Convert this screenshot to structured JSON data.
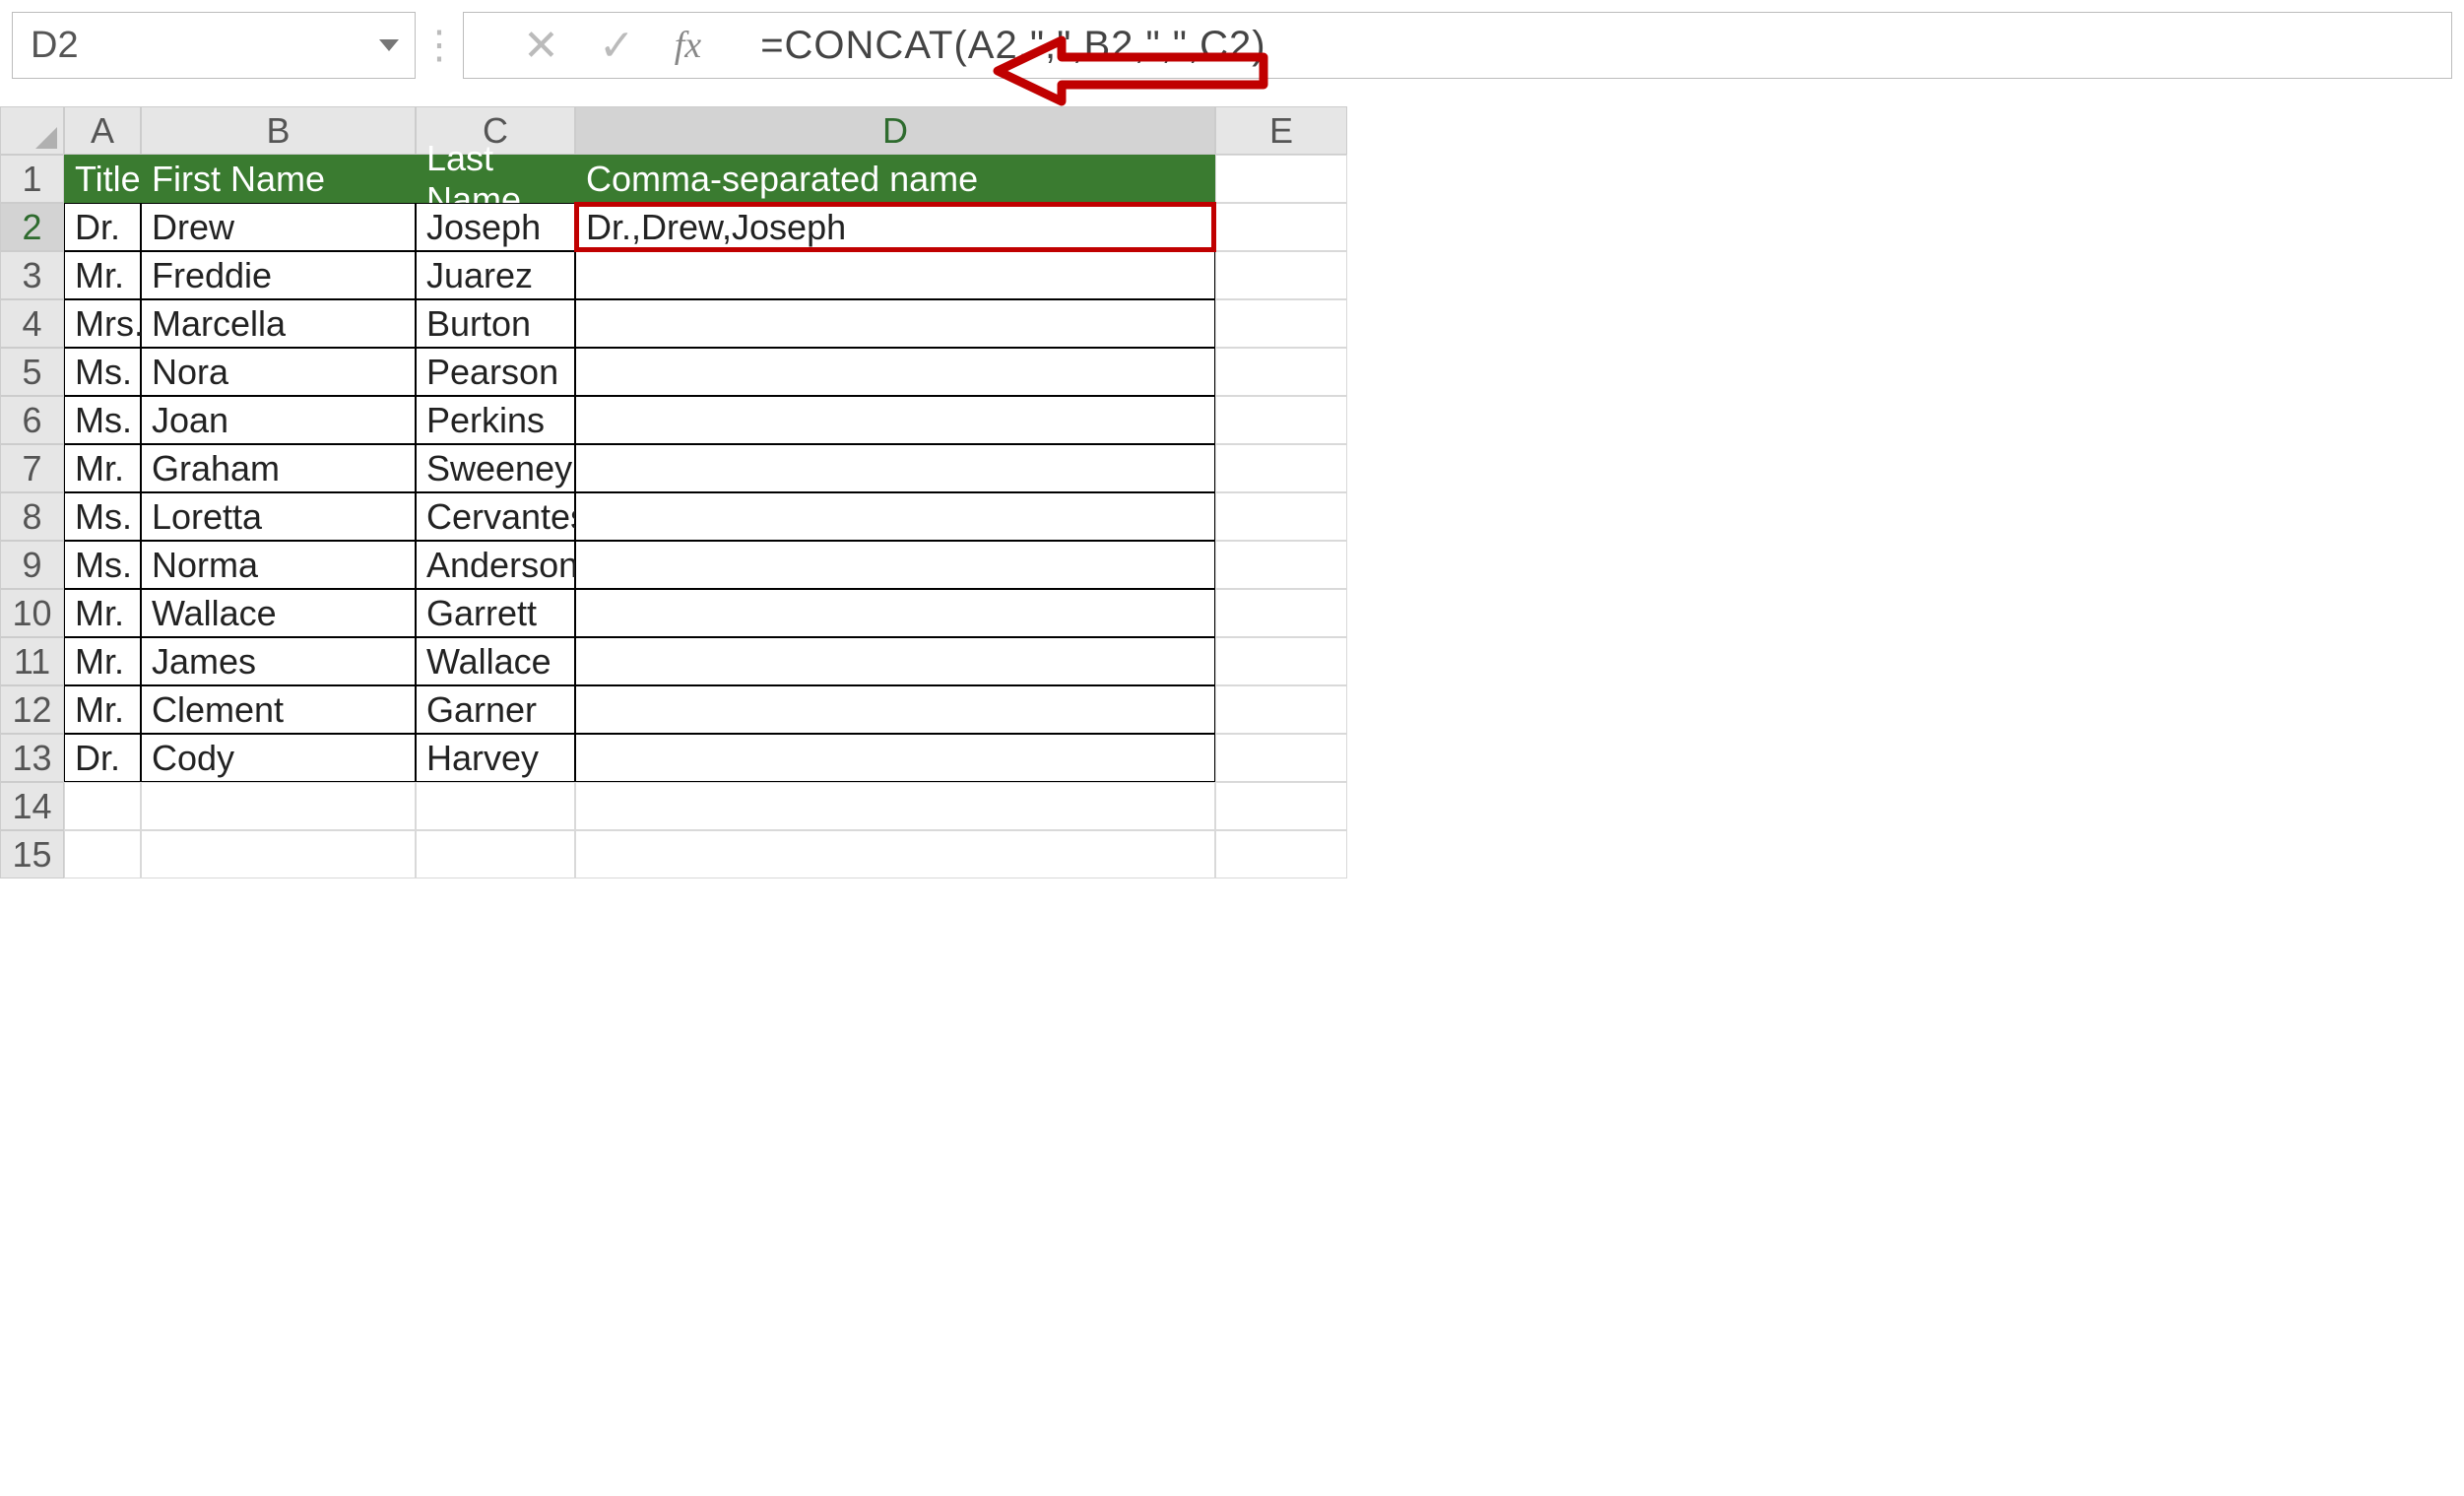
{
  "name_box": {
    "value": "D2"
  },
  "formula_bar": {
    "cancel": "✕",
    "enter": "✓",
    "fx": "fx",
    "formula": "=CONCAT(A2,\",\",B2,\",\",C2)"
  },
  "columns": [
    "A",
    "B",
    "C",
    "D",
    "E"
  ],
  "selected_column": "D",
  "selected_row": "2",
  "row_numbers": [
    "1",
    "2",
    "3",
    "4",
    "5",
    "6",
    "7",
    "8",
    "9",
    "10",
    "11",
    "12",
    "13",
    "14",
    "15"
  ],
  "headers": {
    "title": "Title",
    "first": "First Name",
    "last": "Last Name",
    "combined": "Comma-separated name"
  },
  "rows": [
    {
      "title": "Dr.",
      "first": "Drew",
      "last": "Joseph",
      "combined": "Dr.,Drew,Joseph"
    },
    {
      "title": "Mr.",
      "first": "Freddie",
      "last": "Juarez",
      "combined": ""
    },
    {
      "title": "Mrs.",
      "first": "Marcella",
      "last": "Burton",
      "combined": ""
    },
    {
      "title": "Ms.",
      "first": "Nora",
      "last": "Pearson",
      "combined": ""
    },
    {
      "title": "Ms.",
      "first": "Joan",
      "last": "Perkins",
      "combined": ""
    },
    {
      "title": "Mr.",
      "first": "Graham",
      "last": "Sweeney",
      "combined": ""
    },
    {
      "title": "Ms.",
      "first": "Loretta",
      "last": "Cervantes",
      "combined": ""
    },
    {
      "title": "Ms.",
      "first": "Norma",
      "last": "Anderson",
      "combined": ""
    },
    {
      "title": "Mr.",
      "first": "Wallace",
      "last": "Garrett",
      "combined": ""
    },
    {
      "title": "Mr.",
      "first": "James",
      "last": "Wallace",
      "combined": ""
    },
    {
      "title": "Mr.",
      "first": "Clement",
      "last": "Garner",
      "combined": ""
    },
    {
      "title": "Dr.",
      "first": "Cody",
      "last": "Harvey",
      "combined": ""
    }
  ],
  "annotation": {
    "arrow_color": "#c00000"
  }
}
